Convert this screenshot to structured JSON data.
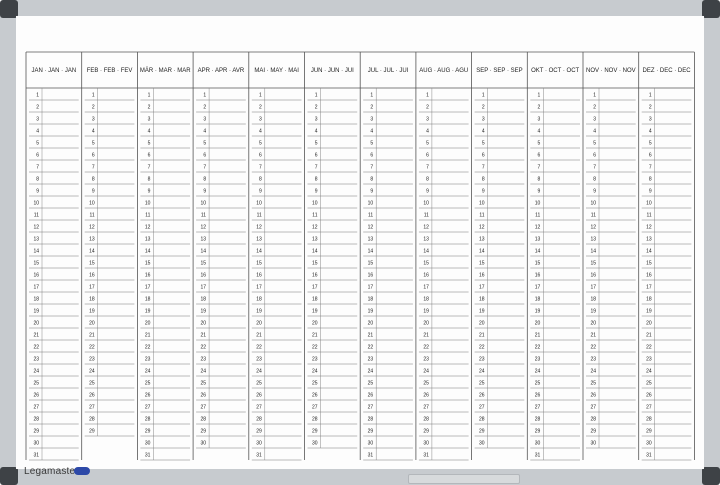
{
  "board": {
    "brand": "Legamaster",
    "months": [
      "JAN · JAN · JAN",
      "FEB · FEB · FEV",
      "MÄR · MAR · MAR",
      "APR · APR · AVR",
      "MAI · MAY · MAI",
      "JUN · JUN · JUI",
      "JUL · JUL · JUI",
      "AUG · AUG · AGU",
      "SEP · SEP · SEP",
      "OKT · OCT · OCT",
      "NOV · NOV · NOV",
      "DEZ · DEC · DEC"
    ],
    "days_per_month": [
      31,
      29,
      31,
      30,
      31,
      30,
      31,
      31,
      30,
      31,
      30,
      31
    ],
    "max_days": 31
  }
}
